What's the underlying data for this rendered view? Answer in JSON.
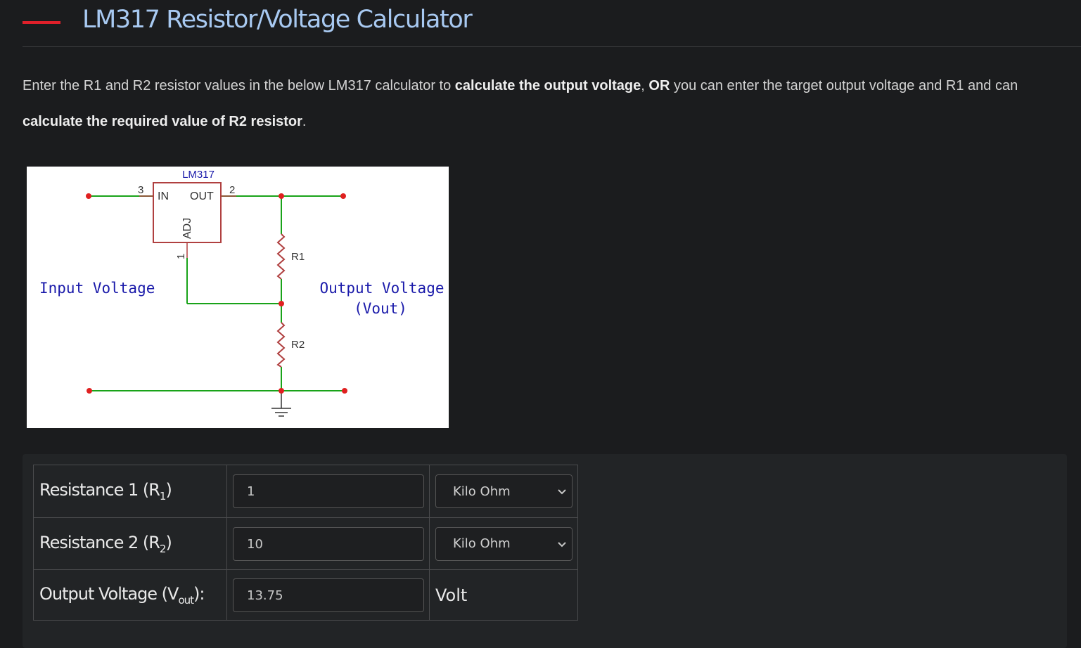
{
  "page": {
    "title": "LM317 Resistor/Voltage Calculator",
    "intro": {
      "p1": "Enter the R1 and R2 resistor values in the below LM317 calculator to ",
      "b1": "calculate the output voltage",
      "p2": ", ",
      "b2": "OR",
      "p3": " you can enter the target output voltage and R1 and can ",
      "b3": "calculate the required  value of R2 resistor",
      "p4": "."
    }
  },
  "schematic": {
    "chip": "LM317",
    "pin_in": "IN",
    "pin_out": "OUT",
    "pin_adj": "ADJ",
    "pin3": "3",
    "pin2": "2",
    "pin1": "1",
    "r1": "R1",
    "r2": "R2",
    "input_label": "Input Voltage",
    "output_label_1": "Output Voltage",
    "output_label_2": "(Vout)",
    "colors": {
      "wire": "#19a319",
      "component": "#b04040",
      "node": "#e02020",
      "text": "#1a1aaa"
    }
  },
  "calculator": {
    "r1": {
      "label": "Resistance 1 (R",
      "sub": "1",
      "close": ")",
      "value": "1",
      "unit": "Kilo Ohm"
    },
    "r2": {
      "label": "Resistance 2 (R",
      "sub": "2",
      "close": ")",
      "value": "10",
      "unit": "Kilo Ohm"
    },
    "vout": {
      "label": "Output Voltage (V",
      "sub": "out",
      "close": "):",
      "value": "13.75",
      "unit": "Volt"
    }
  }
}
